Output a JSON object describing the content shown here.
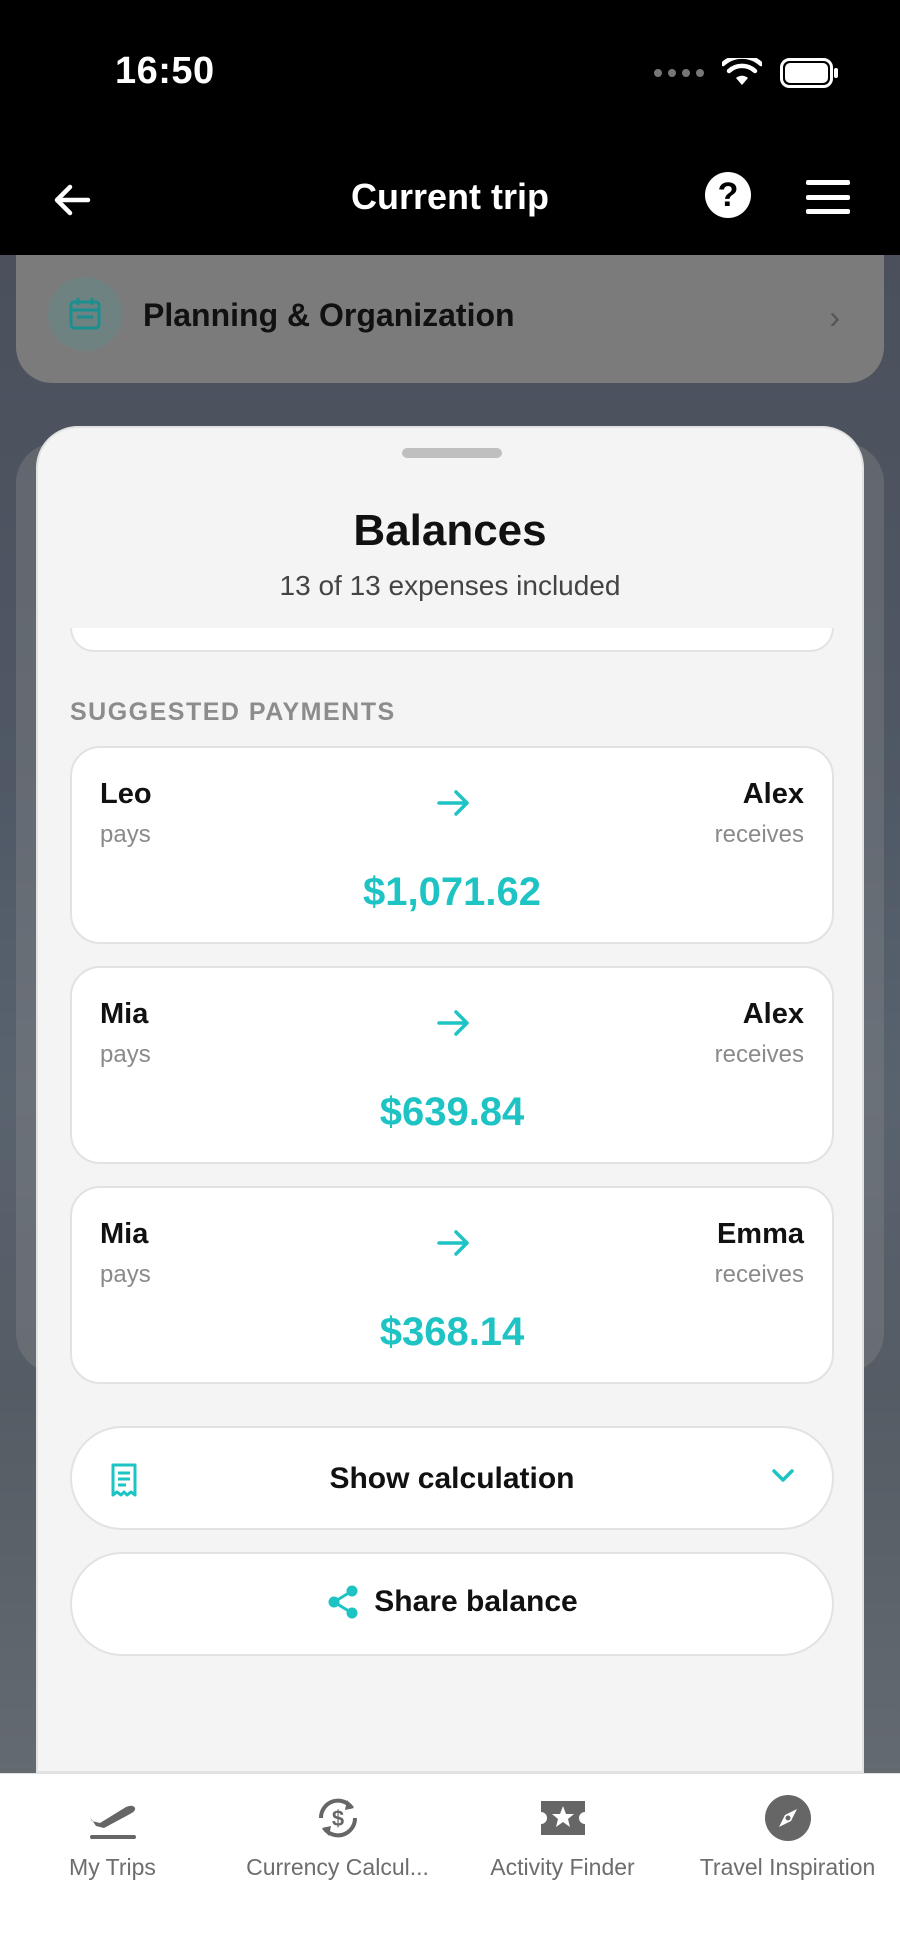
{
  "status_bar": {
    "time": "16:50"
  },
  "nav": {
    "title": "Current trip"
  },
  "background": {
    "planning_label": "Planning & Organization"
  },
  "sheet": {
    "title": "Balances",
    "subtitle": "13 of 13 expenses included",
    "section_heading": "SUGGESTED PAYMENTS",
    "payments": [
      {
        "from": "Leo",
        "from_role": "pays",
        "to": "Alex",
        "to_role": "receives",
        "amount": "$1,071.62"
      },
      {
        "from": "Mia",
        "from_role": "pays",
        "to": "Alex",
        "to_role": "receives",
        "amount": "$639.84"
      },
      {
        "from": "Mia",
        "from_role": "pays",
        "to": "Emma",
        "to_role": "receives",
        "amount": "$368.14"
      }
    ],
    "show_calculation_label": "Show calculation",
    "share_balance_label": "Share balance"
  },
  "tabs": [
    {
      "label": "My Trips",
      "icon": "airplane-takeoff-icon"
    },
    {
      "label": "Currency Calcul...",
      "icon": "currency-exchange-icon"
    },
    {
      "label": "Activity Finder",
      "icon": "star-ticket-icon"
    },
    {
      "label": "Travel Inspiration",
      "icon": "compass-icon"
    }
  ],
  "colors": {
    "accent": "#1ec3c3",
    "nav_background": "#000000",
    "sheet_background": "#f4f4f4"
  }
}
